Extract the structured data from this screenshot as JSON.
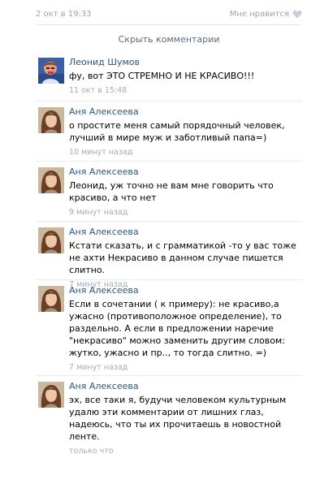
{
  "post": {
    "date": "2 окт в 19:33",
    "like_label": "Мне нравится"
  },
  "hide_comments_label": "Скрыть комментарии",
  "comments": [
    {
      "author": "Леонид Шумов",
      "text": "фу, вот ЭТО СТРЕМНО И НЕ КРАСИВО!!!",
      "time": "11 окт в 15:48"
    },
    {
      "author": "Аня Алексеева",
      "text": "о простите меня самый порядочный человек, лучший в мире муж и заботливый папа=)",
      "time": "10 минут назад"
    },
    {
      "author": "Аня Алексеева",
      "text": "Леонид, уж точно не вам мне говорить что красиво, а что нет",
      "time": "9 минут назад"
    },
    {
      "author": "Аня Алексеева",
      "text": "Кстати сказать, и с грамматикой -то у вас тоже не ахти Некрасиво в данном случае пишется слитно.",
      "time": "7 минут назад"
    },
    {
      "author": "Аня Алексеева",
      "text": "Если в сочетании ( к примеру): не красиво,а ужасно (противоположное определение), то раздельно. А если в предложении наречие \"некрасиво\" можно заменить другим словом: жутко, ужасно и пр.., то тогда слитно. =)",
      "time": "7 минут назад"
    },
    {
      "author": "Аня Алексеева",
      "text": "эх, все таки я, будучи человеком культурным удалю эти комментарии от лишних глаз, надеюсь, что ты их прочитаешь в новостной ленте.",
      "time": "только что"
    }
  ]
}
